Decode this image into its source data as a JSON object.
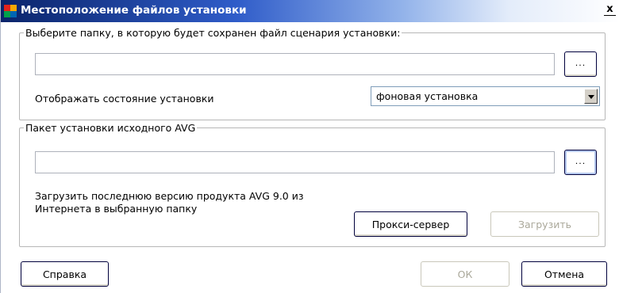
{
  "window": {
    "title": "Местоположение файлов установки",
    "close_glyph": "x",
    "icon": "avg-logo-icon",
    "icon_colors": [
      "#e2231a",
      "#f6a800",
      "#00a14b",
      "#0066b3"
    ]
  },
  "script_group": {
    "legend": "Выберите папку, в которую будет сохранен файл сценария установки:",
    "path_value": "",
    "browse_label": "...",
    "display_state_label": "Отображать состояние установки",
    "display_state_value": "фоновая установка"
  },
  "package_group": {
    "legend": "Пакет установки исходного AVG",
    "path_value": "",
    "browse_label": "...",
    "download_info_line1": "Загрузить последнюю версию продукта AVG 9.0 из",
    "download_info_line2": "Интернета в выбранную папку",
    "proxy_label": "Прокси-сервер",
    "download_label": "Загрузить"
  },
  "footer": {
    "help_label": "Справка",
    "ok_label": "ОК",
    "cancel_label": "Отмена"
  }
}
